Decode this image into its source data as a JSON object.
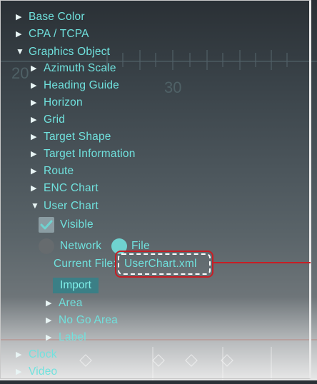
{
  "colors": {
    "text": "#70e2de",
    "callout": "#c71e25",
    "arrow": "#e8f4f4"
  },
  "background": {
    "scale_numbers": [
      "20",
      "30"
    ]
  },
  "menu": {
    "base_color": "Base Color",
    "cpa_tcpa": "CPA / TCPA",
    "graphics_object": "Graphics Object",
    "azimuth_scale": "Azimuth Scale",
    "heading_guide": "Heading Guide",
    "horizon": "Horizon",
    "grid": "Grid",
    "target_shape": "Target Shape",
    "target_information": "Target Information",
    "route": "Route",
    "enc_chart": "ENC Chart",
    "user_chart": "User Chart",
    "visible_label": "Visible",
    "visible_checked": true,
    "network_label": "Network",
    "file_label": "File",
    "source_selected": "File",
    "current_file_label": "Current File:",
    "current_file_value": "UserChart.xml",
    "import_label": "Import",
    "area": "Area",
    "no_go_area": "No Go Area",
    "label": "Label",
    "clock": "Clock",
    "video": "Video"
  },
  "icons": {
    "collapsed": "triangle-right-icon",
    "expanded": "triangle-down-icon",
    "checkbox": "check-icon",
    "radio": "radio-icon"
  }
}
